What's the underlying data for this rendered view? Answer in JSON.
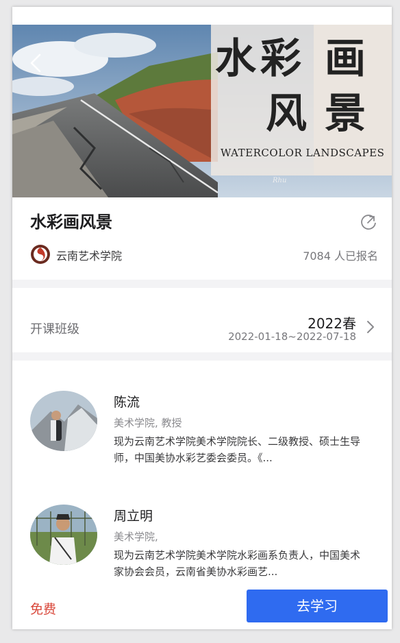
{
  "hero": {
    "title_chars": [
      "水",
      "彩",
      "画",
      "风",
      "景"
    ],
    "subtitle": "WATERCOLOR LANDSCAPES",
    "signature": "Rhu"
  },
  "course": {
    "title": "水彩画风景",
    "school_name": "云南艺术学院",
    "enroll_count": "7084 人已报名"
  },
  "class_info": {
    "label": "开课班级",
    "term": "2022春",
    "dates": "2022-01-18~2022-07-18"
  },
  "teachers": [
    {
      "name": "陈流",
      "dept": "美术学院, 教授",
      "desc": "现为云南艺术学院美术学院院长、二级教授、硕士生导师，中国美协水彩艺委会委员。《..."
    },
    {
      "name": "周立明",
      "dept": "美术学院,",
      "desc": "现为云南艺术学院美术学院水彩画系负责人，中国美术家协会会员，云南省美协水彩画艺..."
    }
  ],
  "bottom": {
    "price": "免费",
    "study_button": "去学习"
  },
  "colors": {
    "accent": "#2f6bf0",
    "price_red": "#d9483b"
  },
  "icons": {
    "back": "chevron-left-icon",
    "share": "share-icon",
    "class_arrow": "chevron-right-icon"
  }
}
